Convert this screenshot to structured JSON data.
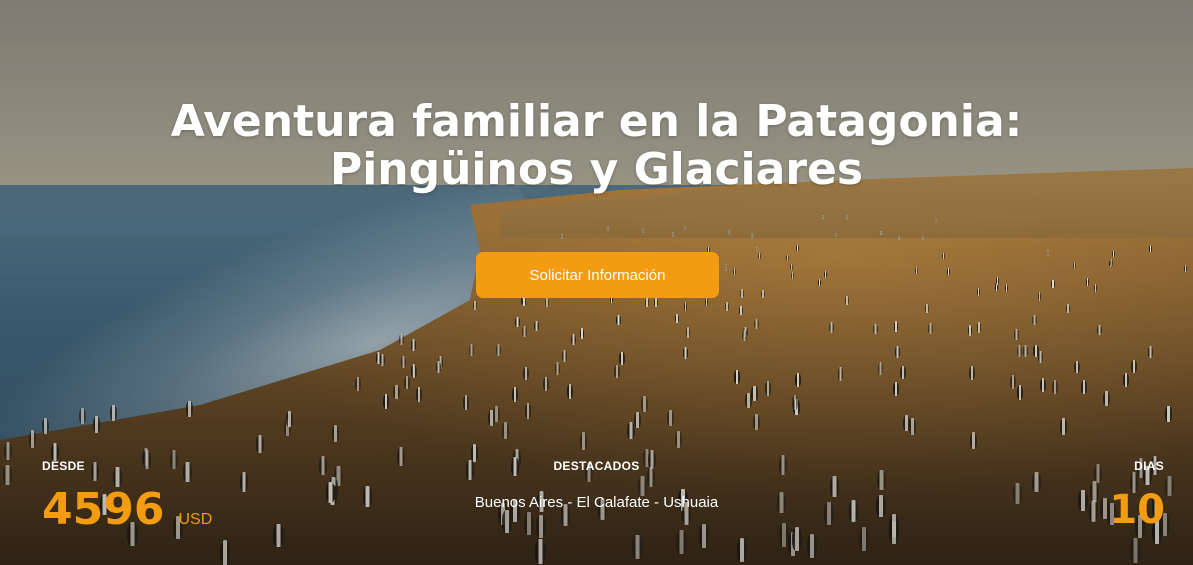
{
  "hero": {
    "title_line1": "Aventura familiar en la Patagonia:",
    "title_line2": "Pingüinos y Glaciares",
    "cta_label": "Solicitar Información"
  },
  "stats": {
    "from_label": "DESDE",
    "price": "4596",
    "currency": "USD",
    "highlights_label": "DESTACADOS",
    "route": "Buenos Aires - El Calafate - Ushuaia",
    "days_label": "DIAS",
    "days": "10"
  },
  "colors": {
    "accent": "#f39c12",
    "text": "#ffffff"
  }
}
